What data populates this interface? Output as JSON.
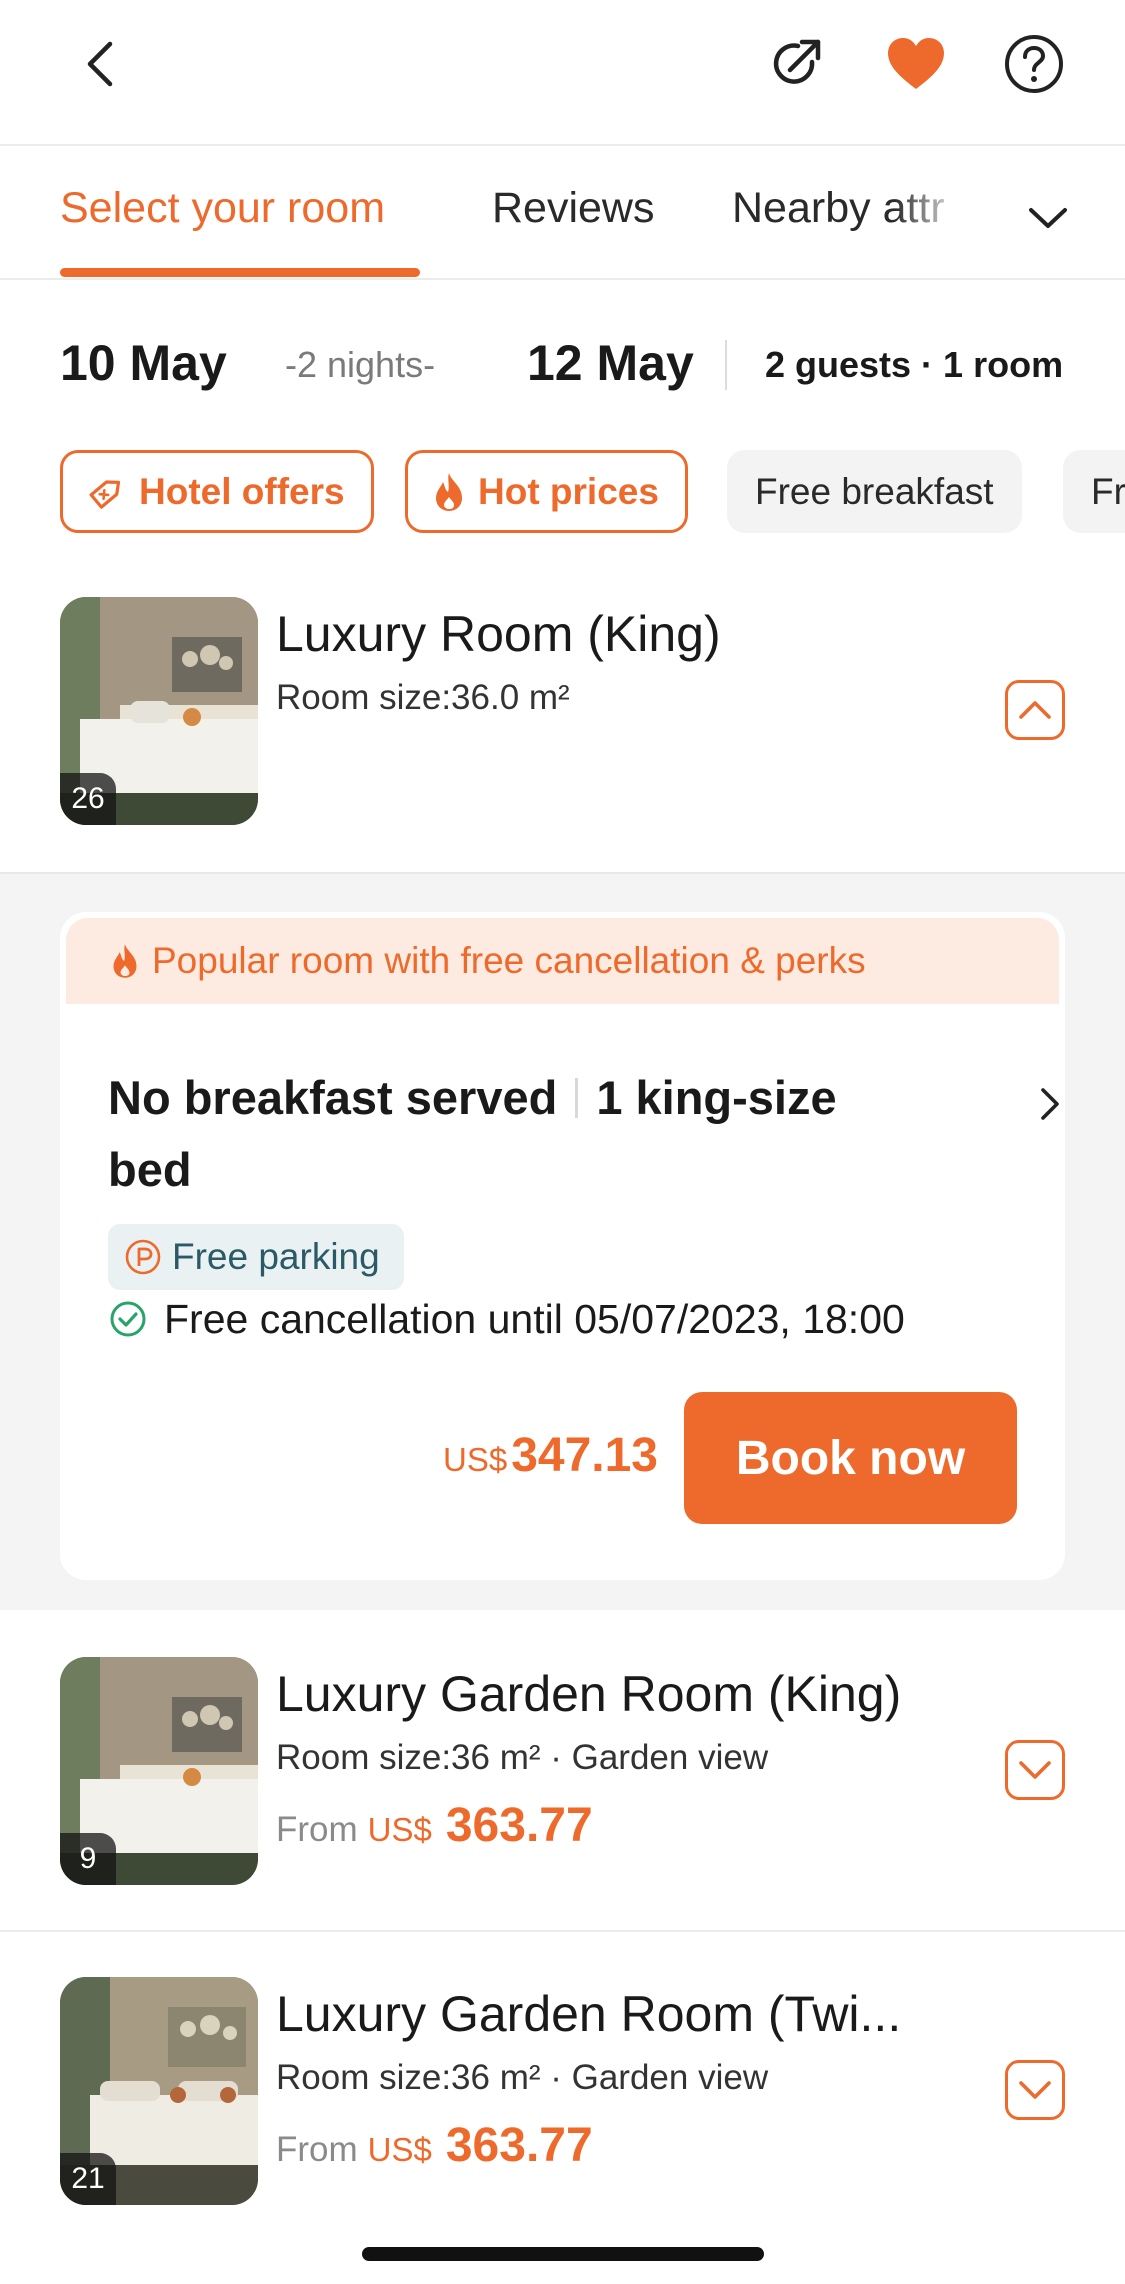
{
  "header": {
    "back_icon": "chevron-left-icon",
    "share_icon": "share-external-icon",
    "favorite_icon": "heart-icon",
    "help_icon": "help-circle-icon",
    "accent": "#ee6a2c"
  },
  "tabs": {
    "items": [
      {
        "label": "Select your room",
        "active": true
      },
      {
        "label": "Reviews",
        "active": false
      },
      {
        "label": "Nearby attr",
        "active": false
      }
    ],
    "more_icon": "chevron-down-icon"
  },
  "stay": {
    "check_in": "10 May",
    "nights": "-2 nights-",
    "check_out": "12 May",
    "guests": "2 guests · 1 room"
  },
  "filters": [
    {
      "label": "Hotel offers",
      "icon": "tag-icon",
      "style": "outline"
    },
    {
      "label": "Hot prices",
      "icon": "flame-icon",
      "style": "outline"
    },
    {
      "label": "Free breakfast",
      "style": "gray"
    },
    {
      "label": "Fre",
      "style": "gray"
    }
  ],
  "rooms": [
    {
      "title": "Luxury Room (King)",
      "subtitle": "Room size:36.0 m²",
      "photo_count": "26",
      "expanded": true
    },
    {
      "title": "Luxury Garden Room (King)",
      "subtitle": "Room size:36 m² · Garden view",
      "from_label": "From",
      "currency": "US$",
      "price": "363.77",
      "photo_count": "9",
      "expanded": false
    },
    {
      "title": "Luxury Garden Room (Twi...",
      "subtitle": "Room size:36 m² · Garden view",
      "from_label": "From",
      "currency": "US$",
      "price": "363.77",
      "photo_count": "21",
      "expanded": false
    }
  ],
  "offer": {
    "banner": "Popular room with free cancellation & perks",
    "meal": "No breakfast served",
    "bed_line1": "1 king-size",
    "bed_line2": "bed",
    "perk": "Free parking",
    "cancellation": "Free cancellation until 05/07/2023, 18:00",
    "currency": "US$",
    "price": "347.13",
    "book_label": "Book now"
  }
}
